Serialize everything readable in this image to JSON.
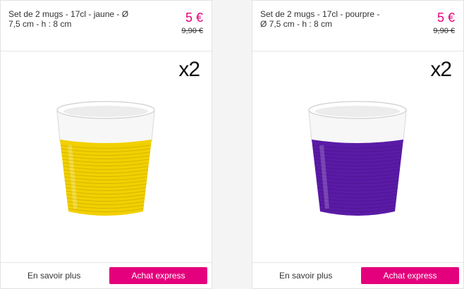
{
  "products": [
    {
      "title": "Set de 2 mugs - 17cl - jaune - Ø 7,5 cm - h : 8 cm",
      "price": "5 €",
      "old_price": "9,90 €",
      "quantity_badge": "x2",
      "sleeve_color": "#f2d000",
      "more_label": "En savoir plus",
      "buy_label": "Achat express"
    },
    {
      "title": "Set de 2 mugs - 17cl - pourpre - Ø 7,5 cm - h : 8 cm",
      "price": "5 €",
      "old_price": "9,90 €",
      "quantity_badge": "x2",
      "sleeve_color": "#5a1aa6",
      "more_label": "En savoir plus",
      "buy_label": "Achat express"
    }
  ],
  "colors": {
    "accent": "#e4007c"
  },
  "icons": [
    "mug-image",
    "mug-image"
  ]
}
